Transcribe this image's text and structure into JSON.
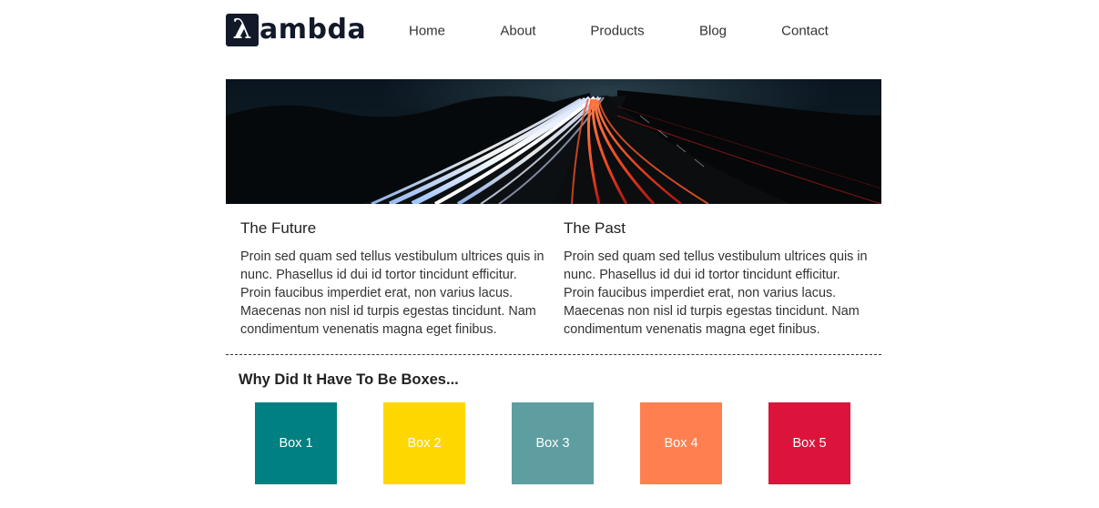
{
  "logo": {
    "mark": "λ",
    "text": "ambda"
  },
  "nav": [
    {
      "label": "Home"
    },
    {
      "label": "About"
    },
    {
      "label": "Products"
    },
    {
      "label": "Blog"
    },
    {
      "label": "Contact"
    }
  ],
  "hero": {
    "icon": "night-highway-light-trails-image"
  },
  "sections": {
    "future": {
      "heading": "The Future",
      "body": "Proin sed quam sed tellus vestibulum ultrices quis in nunc. Phasellus id dui id tortor tincidunt efficitur. Proin faucibus imperdiet erat, non varius lacus. Maecenas non nisl id turpis egestas tincidunt. Nam condimentum venenatis magna eget finibus."
    },
    "past": {
      "heading": "The Past",
      "body": "Proin sed quam sed tellus vestibulum ultrices quis in nunc. Phasellus id dui id tortor tincidunt efficitur. Proin faucibus imperdiet erat, non varius lacus. Maecenas non nisl id turpis egestas tincidunt. Nam condimentum venenatis magna eget finibus."
    }
  },
  "boxes": {
    "title": "Why Did It Have To Be Boxes...",
    "items": [
      {
        "label": "Box 1",
        "color": "#008080"
      },
      {
        "label": "Box 2",
        "color": "#FFD700"
      },
      {
        "label": "Box 3",
        "color": "#5F9EA0"
      },
      {
        "label": "Box 4",
        "color": "#FF7F50"
      },
      {
        "label": "Box 5",
        "color": "#DC143C"
      }
    ]
  }
}
